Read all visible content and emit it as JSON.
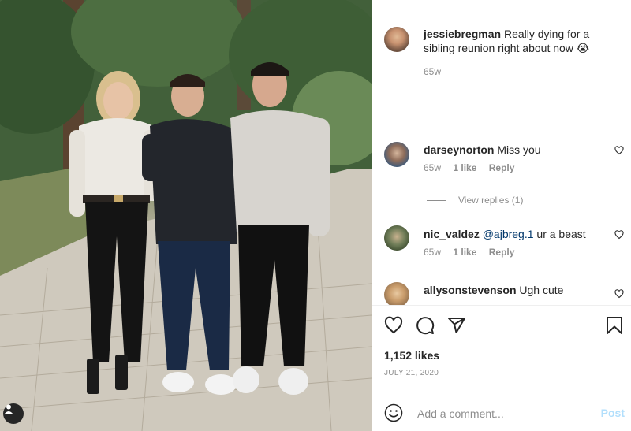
{
  "post": {
    "photo_alt": "Three siblings standing on a brick path",
    "caption": {
      "username": "jessiebregman",
      "text": "Really dying for a sibling reunion right about now 😭",
      "time": "65w"
    },
    "comments": [
      {
        "username": "darseynorton",
        "mention": "",
        "text": "Miss you",
        "time": "65w",
        "likes": "1 like",
        "reply": "Reply"
      },
      {
        "username": "nic_valdez",
        "mention": "@ajbreg.1",
        "text": "ur a beast",
        "time": "65w",
        "likes": "1 like",
        "reply": "Reply"
      },
      {
        "username": "allysonstevenson",
        "mention": "",
        "text": "Ugh cute",
        "time": "",
        "likes": "",
        "reply": ""
      }
    ],
    "view_replies": "View replies (1)",
    "likes": "1,152 likes",
    "date": "JULY 21, 2020",
    "add_comment": {
      "placeholder": "Add a comment...",
      "post_label": "Post"
    }
  },
  "colors": {
    "text": "#262626",
    "muted": "#8e8e8e",
    "post_disabled": "#b2dffc",
    "divider": "#efefef"
  },
  "icons": [
    "user-tag-icon",
    "heart-icon",
    "comment-icon",
    "share-icon",
    "bookmark-icon",
    "emoji-icon"
  ]
}
